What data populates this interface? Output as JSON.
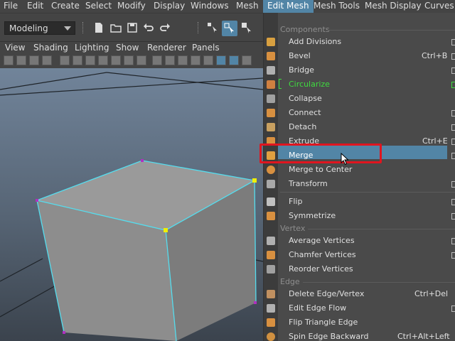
{
  "menubar": {
    "items": [
      "File",
      "Edit",
      "Create",
      "Select",
      "Modify",
      "Display",
      "Windows",
      "Mesh",
      "Edit Mesh",
      "Mesh Tools",
      "Mesh Display",
      "Curves"
    ],
    "active": "Edit Mesh"
  },
  "toolbar": {
    "mode": "Modeling"
  },
  "viewport_menu": {
    "items": [
      "View",
      "Shading",
      "Lighting",
      "Show",
      "Renderer",
      "Panels"
    ]
  },
  "edit_mesh_menu": {
    "sections": {
      "components": "Components",
      "vertex": "Vertex",
      "edge": "Edge"
    },
    "items": {
      "add_divisions": "Add Divisions",
      "bevel": "Bevel",
      "bridge": "Bridge",
      "circularize": "Circularize",
      "collapse": "Collapse",
      "connect": "Connect",
      "detach": "Detach",
      "extrude": "Extrude",
      "merge": "Merge",
      "merge_to_center": "Merge to Center",
      "transform": "Transform",
      "flip": "Flip",
      "symmetrize": "Symmetrize",
      "average_vertices": "Average Vertices",
      "chamfer_vertices": "Chamfer Vertices",
      "reorder_vertices": "Reorder Vertices",
      "delete_edge_vertex": "Delete Edge/Vertex",
      "edit_edge_flow": "Edit Edge Flow",
      "flip_triangle_edge": "Flip Triangle Edge",
      "spin_edge_backward": "Spin Edge Backward"
    },
    "shortcuts": {
      "bevel": "Ctrl+B",
      "extrude": "Ctrl+E",
      "delete_edge_vertex": "Ctrl+Del",
      "spin_edge_backward": "Ctrl+Alt+Left"
    },
    "highlighted": "Merge"
  },
  "colors": {
    "accent": "#5285a6",
    "highlight_box": "#e0151f",
    "green_item": "#3fdc3f"
  }
}
